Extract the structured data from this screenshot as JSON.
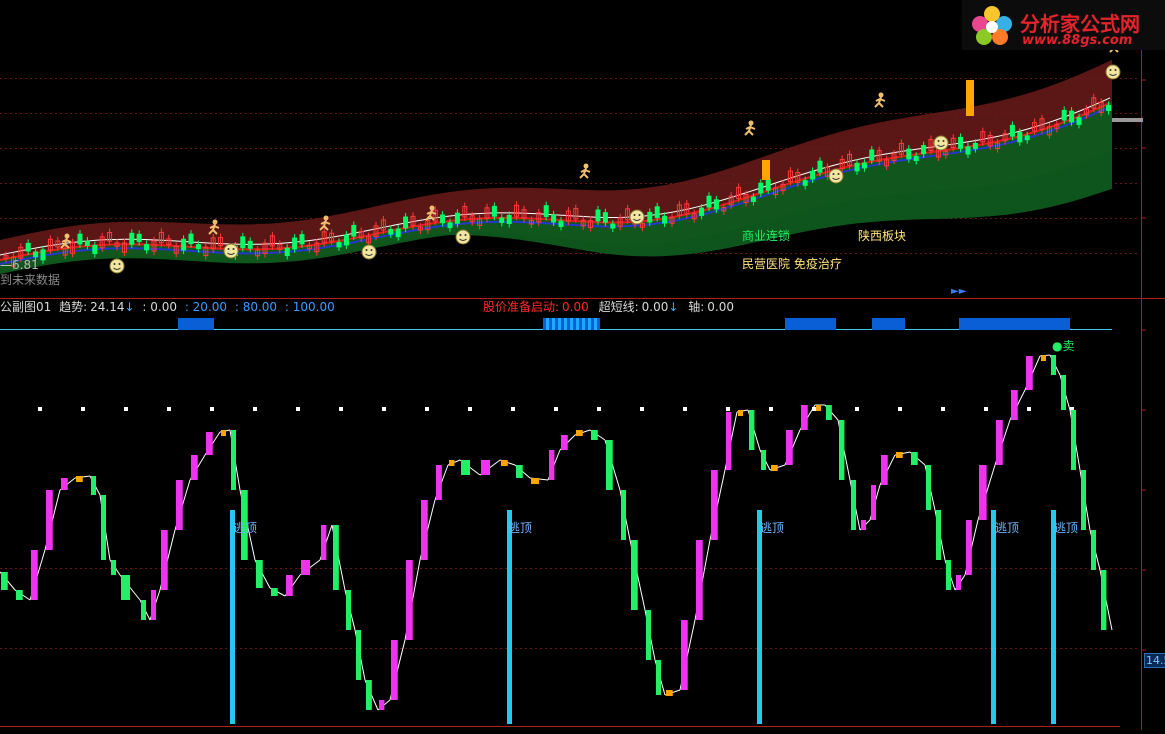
{
  "logo": {
    "title": "分析家公式网",
    "url": "www.88gs.com"
  },
  "main_chart": {
    "price_label": "6.81",
    "future_data_label": "到未来数据",
    "sector_labels": {
      "commerce_chain": "商业连锁",
      "shaanxi": "陕西板块",
      "private_hospital": "民营医院 免疫治疗"
    }
  },
  "sub_header": {
    "name": "公副图01",
    "trend_label": "趋势:",
    "trend_value": "24.14",
    "v0": ": 0.00",
    "v20": ": 20.00",
    "v80": ": 80.00",
    "v100": ": 100.00",
    "start_label": "股价准备启动:",
    "start_value": "0.00",
    "ultrashort_label": "超短线:",
    "ultrashort_value": "0.00",
    "axis_label": "轴:",
    "axis_value": "0.00"
  },
  "sub_chart": {
    "escape_label": "逃顶",
    "sell_label": "●卖",
    "right_axis_value": "14.5"
  },
  "colors": {
    "up_candle": "#ff3a3a",
    "down_candle": "#00ff66",
    "magenta": "#ee33ee",
    "green": "#22ee66",
    "orange": "#ffa500",
    "cyan": "#27c8ee",
    "header_red": "#ff2a2a",
    "header_blue": "#3a9cff"
  }
}
